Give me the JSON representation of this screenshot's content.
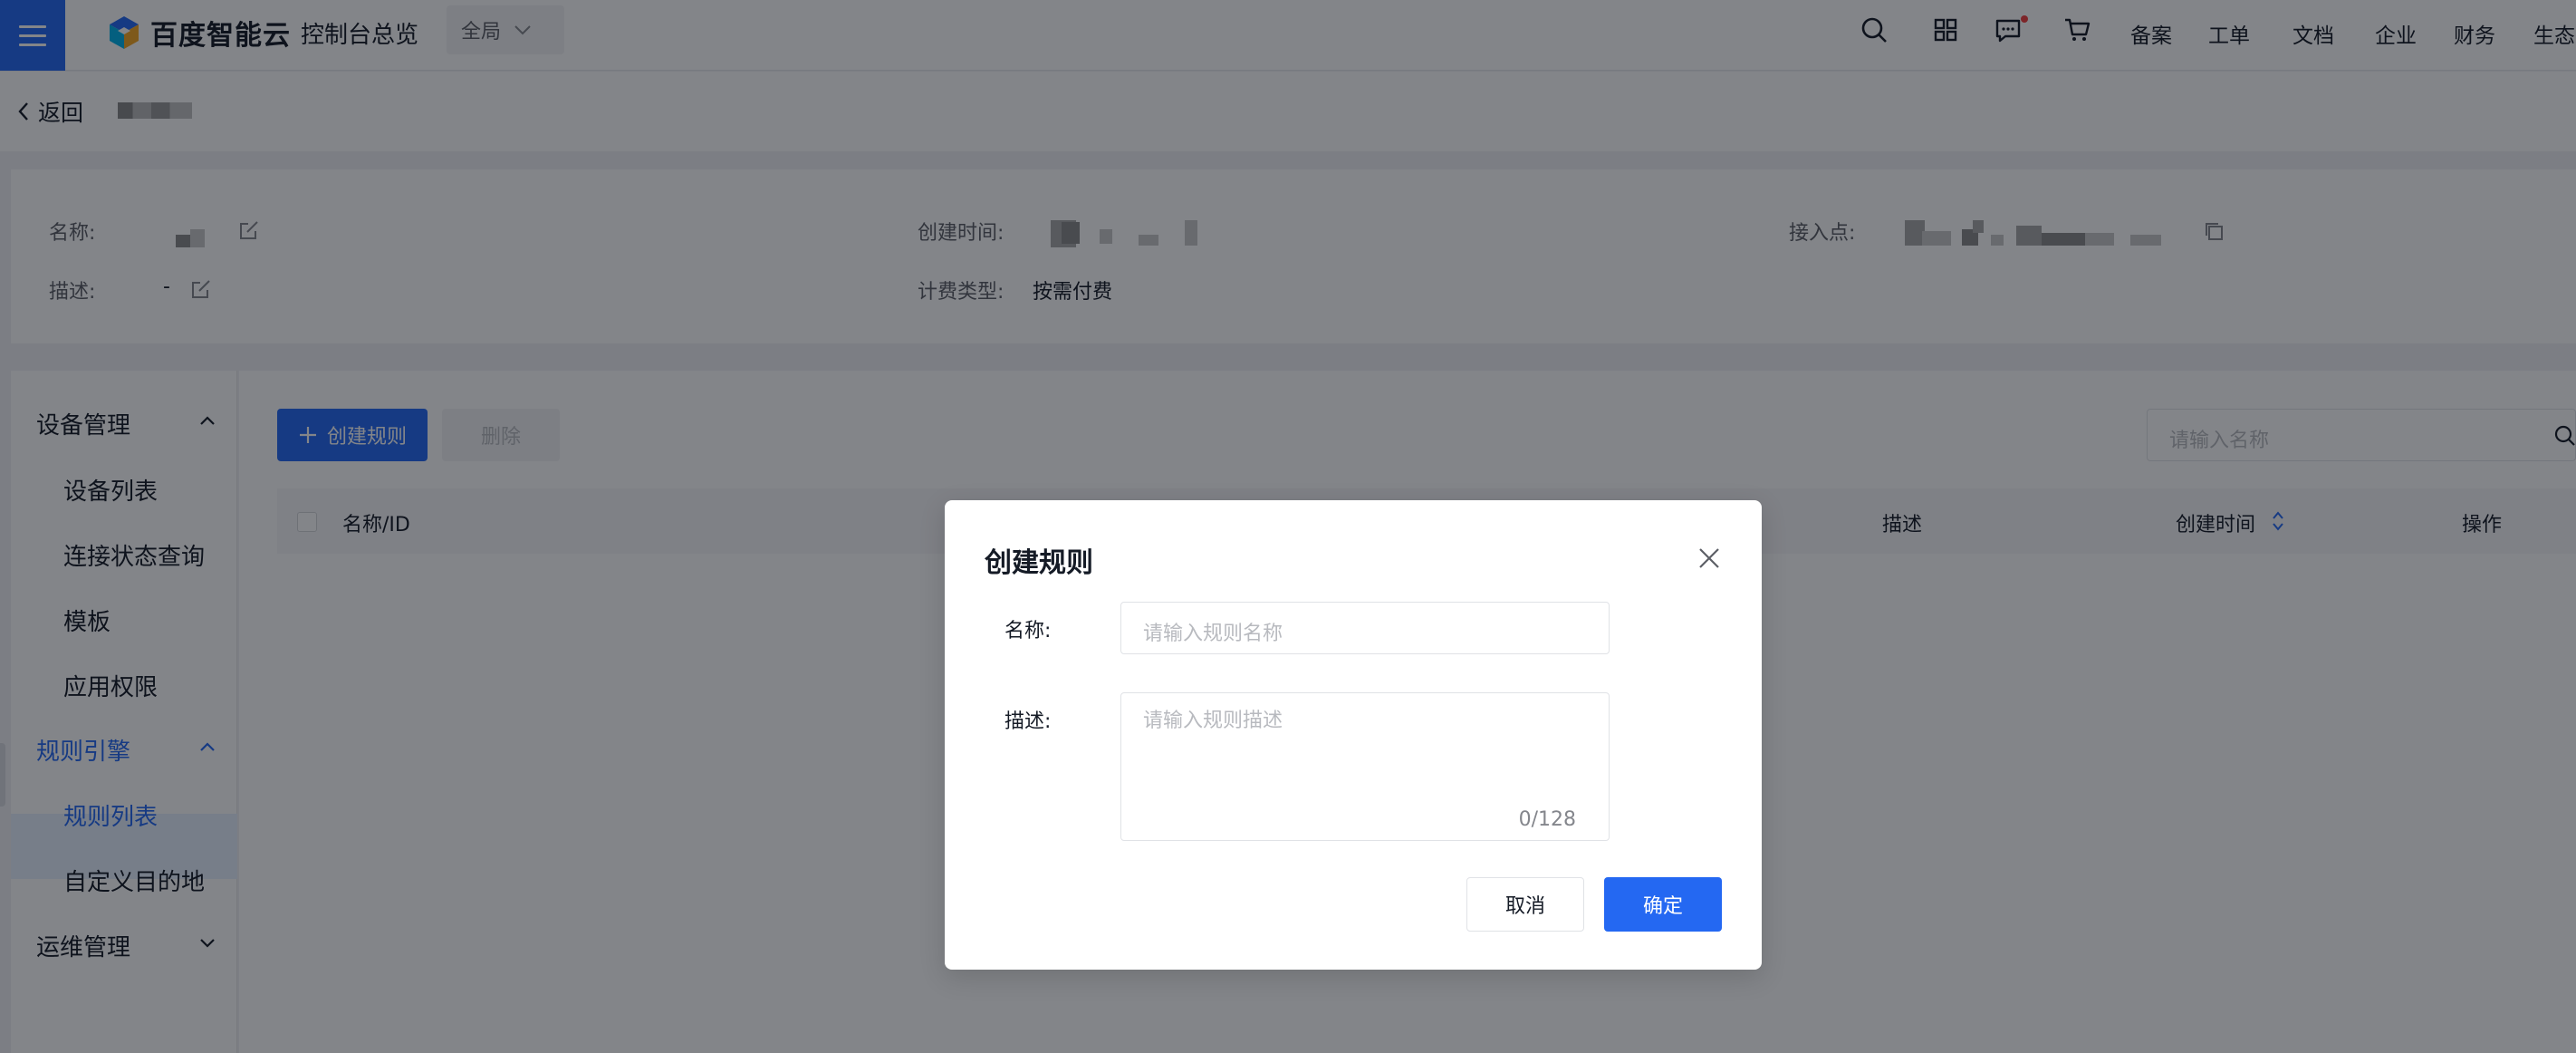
{
  "header": {
    "logo_text": "百度智能云",
    "console_title": "控制台总览",
    "scope_label": "全局",
    "icons": [
      "search-icon",
      "apps-icon",
      "message-icon",
      "cart-icon"
    ],
    "nav_links": [
      "备案",
      "工单",
      "文档",
      "企业",
      "财务",
      "生态"
    ]
  },
  "breadcrumb": {
    "back_label": "返回"
  },
  "info": {
    "name_label": "名称:",
    "desc_label": "描述:",
    "desc_value": "-",
    "created_label": "创建时间:",
    "billing_label": "计费类型:",
    "billing_value": "按需付费",
    "endpoint_label": "接入点:"
  },
  "sidebar": {
    "groups": [
      {
        "label": "设备管理",
        "expanded": true,
        "items": [
          "设备列表",
          "连接状态查询",
          "模板",
          "应用权限"
        ]
      },
      {
        "label": "规则引擎",
        "expanded": true,
        "active": true,
        "items": [
          "规则列表",
          "自定义目的地"
        ],
        "selected_item": "规则列表"
      },
      {
        "label": "运维管理",
        "expanded": false,
        "items": []
      }
    ]
  },
  "toolbar": {
    "create_label": "创建规则",
    "delete_label": "删除",
    "search_placeholder": "请输入名称"
  },
  "table": {
    "columns": [
      "名称/ID",
      "描述",
      "创建时间",
      "操作"
    ]
  },
  "dialog": {
    "title": "创建规则",
    "name_label": "名称:",
    "name_placeholder": "请输入规则名称",
    "desc_label": "描述:",
    "desc_placeholder": "请输入规则描述",
    "desc_counter": "0/128",
    "cancel_label": "取消",
    "confirm_label": "确定"
  },
  "colors": {
    "primary": "#2468f2",
    "text": "#151b26",
    "muted": "#5c5f66",
    "placeholder": "#b8babf",
    "badge": "#f33e3e"
  }
}
